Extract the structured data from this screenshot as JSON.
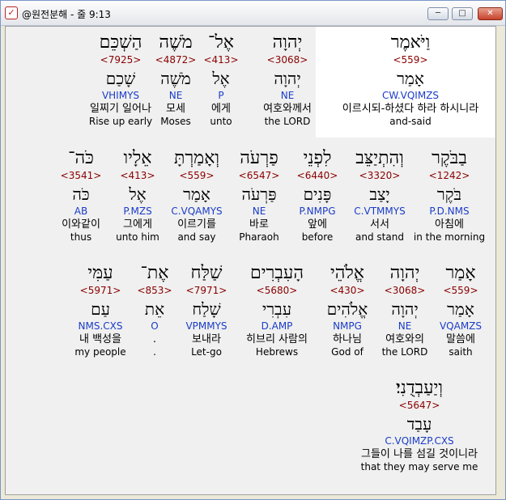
{
  "window": {
    "title": "@원전분해 - 줄 9:13",
    "minimize": "─",
    "maximize": "□",
    "close": "✕"
  },
  "lines": [
    [
      {
        "heb": "וַיֹּאמֶר",
        "sn": "<559>",
        "root": "אָמַר",
        "morph": "CW.VQIMZS",
        "ko": "이르시되-하셨다 하라 하시니라",
        "en": "and-said"
      },
      {
        "heb": "יְהוָה",
        "sn": "<3068>",
        "root": "יְהוָה",
        "morph": "NE",
        "ko": "여호와께서",
        "en": "the LORD"
      },
      {
        "heb": "אֶל־",
        "sn": "<413>",
        "root": "אֶל",
        "morph": "P",
        "ko": "에게",
        "en": "unto"
      },
      {
        "heb": "מֹשֶׁה",
        "sn": "<4872>",
        "root": "מֹשֶׁה",
        "morph": "NE",
        "ko": "모세",
        "en": "Moses"
      },
      {
        "heb": "הַשְׁכֵּם",
        "sn": "<7925>",
        "root": "שָׁכַם",
        "morph": "VHIMYS",
        "ko": "일찌기 일어나",
        "en": "Rise up early"
      }
    ],
    [
      {
        "heb": "בַבֹּקֶר",
        "sn": "<1242>",
        "root": "בֹּקֶר",
        "morph": "P.D.NMS",
        "ko": "아침에",
        "en": "in the morning"
      },
      {
        "heb": "וְהִתְיַצֵּב",
        "sn": "<3320>",
        "root": "יָצַב",
        "morph": "C.VTMMYS",
        "ko": "서서",
        "en": "and stand"
      },
      {
        "heb": "לִפְנֵי",
        "sn": "<6440>",
        "root": "פָּנִים",
        "morph": "P.NMPG",
        "ko": "앞에",
        "en": "before"
      },
      {
        "heb": "פַרְעֹה",
        "sn": "<6547>",
        "root": "פַּרְעֹה",
        "morph": "NE",
        "ko": "바로",
        "en": "Pharaoh"
      },
      {
        "heb": "וְאָמַרְתָּ",
        "sn": "<559>",
        "root": "אָמַר",
        "morph": "C.VQAMYS",
        "ko": "이르기를",
        "en": "and say"
      },
      {
        "heb": "אֵלָיו",
        "sn": "<413>",
        "root": "אֶל",
        "morph": "P.MZS",
        "ko": "그에게",
        "en": "unto him"
      },
      {
        "heb": "כֹּה־",
        "sn": "<3541>",
        "root": "כֹּה",
        "morph": "AB",
        "ko": "이와같이",
        "en": "thus"
      }
    ],
    [
      {
        "heb": "אָמַר",
        "sn": "<559>",
        "root": "אָמַר",
        "morph": "VQAMZS",
        "ko": "말씀에",
        "en": "saith"
      },
      {
        "heb": "יְהוָה",
        "sn": "<3068>",
        "root": "יְהוָה",
        "morph": "NE",
        "ko": "여호와의",
        "en": "the LORD"
      },
      {
        "heb": "אֱלֹהֵי",
        "sn": "<430>",
        "root": "אֱלֹהִים",
        "morph": "NMPG",
        "ko": "하나님",
        "en": "God of"
      },
      {
        "heb": "הָעִבְרִים",
        "sn": "<5680>",
        "root": "עִבְרִי",
        "morph": "D.AMP",
        "ko": "히브리 사람의",
        "en": "Hebrews"
      },
      {
        "heb": "שַׁלַּח",
        "sn": "<7971>",
        "root": "שָׁלַח",
        "morph": "VPMMYS",
        "ko": "보내라",
        "en": "Let-go"
      },
      {
        "heb": "אֶת־",
        "sn": "<853>",
        "root": "אֵת",
        "morph": "O",
        "ko": ".",
        "en": "."
      },
      {
        "heb": "עַמִּי",
        "sn": "<5971>",
        "root": "עַם",
        "morph": "NMS.CXS",
        "ko": "내 백성을",
        "en": "my people"
      }
    ],
    [
      {
        "heb": "וְיַעַבְדֻנִי׃",
        "sn": "<5647>",
        "root": "עָבַד",
        "morph": "C.VQIMZP.CXS",
        "ko": "그들이 나를 섬길 것이니라",
        "en": "that they may serve me"
      }
    ]
  ]
}
